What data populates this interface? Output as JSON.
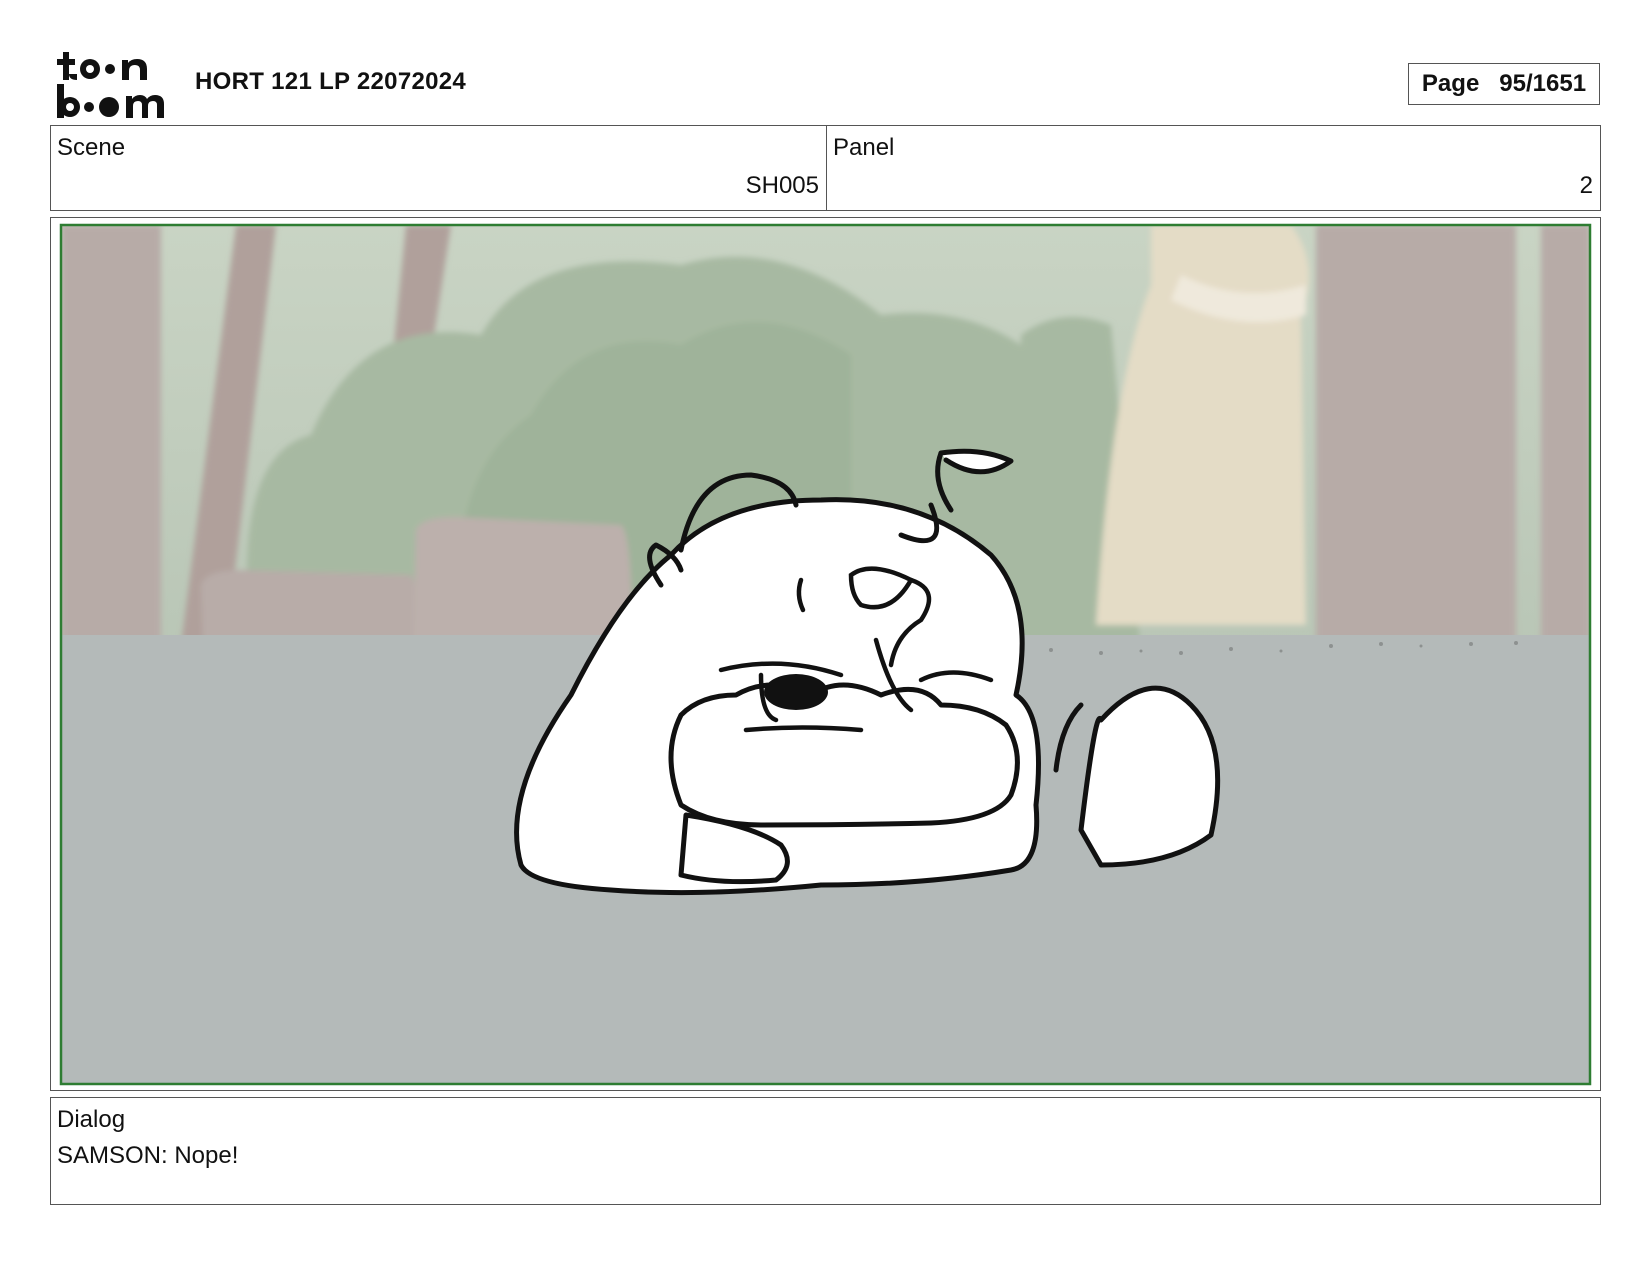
{
  "header": {
    "logo_text": "toon boom",
    "project_title": "HORT 121 LP 22072024",
    "page_label": "Page",
    "page_number": "95/1651"
  },
  "scene": {
    "label": "Scene",
    "value": "SH005"
  },
  "panel": {
    "label": "Panel",
    "value": "2"
  },
  "dialog": {
    "label": "Dialog",
    "text": "SAMSON: Nope!"
  },
  "frame": {
    "safe_border_color": "#2e7d32"
  }
}
